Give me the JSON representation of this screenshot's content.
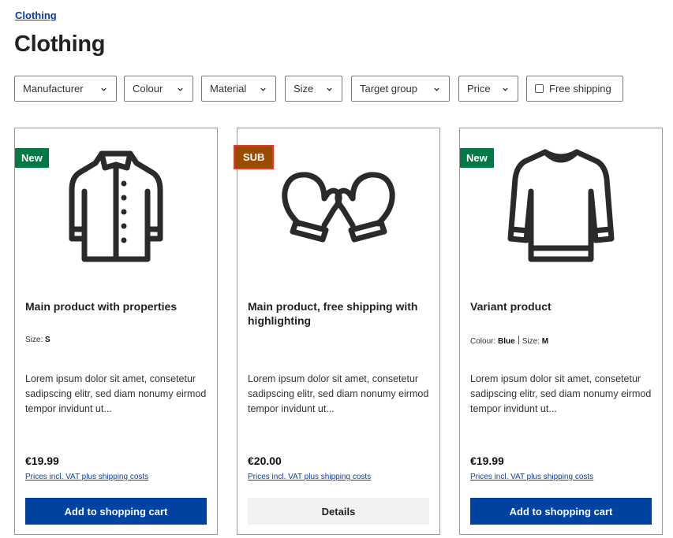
{
  "breadcrumb": "Clothing",
  "page_title": "Clothing",
  "filters": {
    "manufacturer": "Manufacturer",
    "colour": "Colour",
    "material": "Material",
    "size": "Size",
    "target_group": "Target group",
    "price": "Price",
    "free_shipping": "Free shipping"
  },
  "products": [
    {
      "badge": "New",
      "icon": "jacket-icon",
      "name": "Main product with properties",
      "props": [
        {
          "label": "Size:",
          "value": "S"
        }
      ],
      "description": "Lorem ipsum dolor sit amet, consetetur sadipscing elitr, sed diam nonumy eirmod tempor invidunt ut...",
      "price": "€19.99",
      "shipping": "Prices incl. VAT plus shipping costs",
      "button": "Add to shopping cart"
    },
    {
      "badge": "SUB",
      "icon": "mittens-icon",
      "name": "Main product, free shipping with highlighting",
      "props": [],
      "description": "Lorem ipsum dolor sit amet, consetetur sadipscing elitr, sed diam nonumy eirmod tempor invidunt ut...",
      "price": "€20.00",
      "shipping": "Prices incl. VAT plus shipping costs",
      "button": "Details"
    },
    {
      "badge": "New",
      "icon": "sweater-icon",
      "name": "Variant product",
      "props": [
        {
          "label": "Colour:",
          "value": "Blue"
        },
        {
          "label": "Size:",
          "value": "M"
        }
      ],
      "description": "Lorem ipsum dolor sit amet, consetetur sadipscing elitr, sed diam nonumy eirmod tempor invidunt ut...",
      "price": "€19.99",
      "shipping": "Prices incl. VAT plus shipping costs",
      "button": "Add to shopping cart"
    }
  ],
  "colors": {
    "primary": "#0042a0",
    "badge_new": "#007a45",
    "badge_sub": "#9c4a00",
    "link": "#0b3ea8"
  }
}
